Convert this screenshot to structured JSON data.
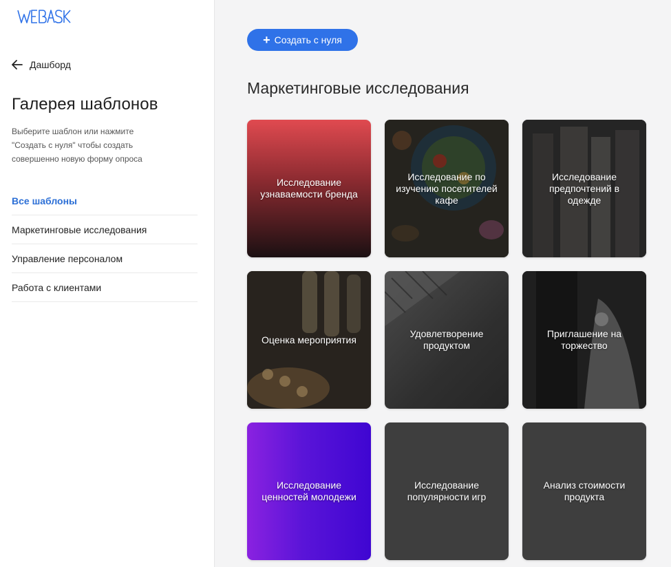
{
  "brand": {
    "logo_text": "WEBASK",
    "accent": "#2f72e8"
  },
  "sidebar": {
    "back_label": "Дашборд",
    "title": "Галерея шаблонов",
    "description": "Выберите шаблон или нажмите \"Создать с нуля\" чтобы создать совершенно новую форму опроса",
    "categories": [
      {
        "label": "Все шаблоны",
        "active": true
      },
      {
        "label": "Маркетинговые исследования",
        "active": false
      },
      {
        "label": "Управление персоналом",
        "active": false
      },
      {
        "label": "Работа с клиентами",
        "active": false
      }
    ]
  },
  "main": {
    "create_button_label": "Создать с нуля",
    "section_title": "Маркетинговые исследования",
    "templates": [
      {
        "label": "Исследование узнаваемости бренда"
      },
      {
        "label": "Исследование по изучению посетителей кафе"
      },
      {
        "label": "Исследование предпочтений в одежде"
      },
      {
        "label": "Оценка мероприятия"
      },
      {
        "label": "Удовлетворение продуктом"
      },
      {
        "label": "Приглашение на торжество"
      },
      {
        "label": "Исследование ценностей молодежи"
      },
      {
        "label": "Исследование популярности игр"
      },
      {
        "label": "Анализ стоимости продукта"
      }
    ]
  }
}
